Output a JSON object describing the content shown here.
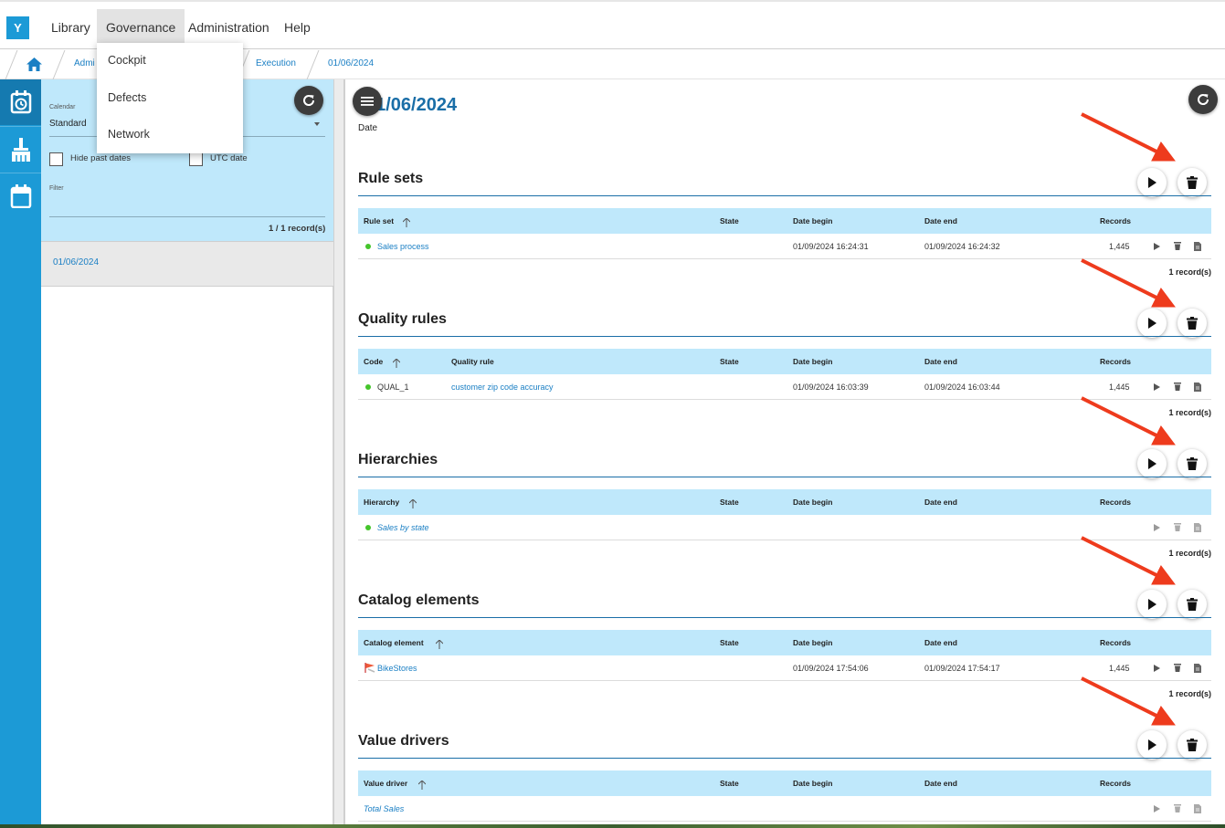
{
  "logo": "Y",
  "menu": [
    "Library",
    "Governance",
    "Administration",
    "Help"
  ],
  "dropdown": [
    "Cockpit",
    "Defects",
    "Network"
  ],
  "breadcrumb": [
    "Admi",
    "Execution",
    "01/06/2024"
  ],
  "left": {
    "calendar_label": "Calendar",
    "calendar_value": "Standard",
    "hide_past": "Hide past dates",
    "utc": "UTC date",
    "filter_label": "Filter",
    "count": "1 / 1 record(s)",
    "item": "01/06/2024"
  },
  "main": {
    "title": "01/06/2024",
    "subtitle": "Date"
  },
  "sections": [
    {
      "title": "Rule sets",
      "headers": [
        "Rule set",
        "State",
        "Date begin",
        "Date end",
        "Records"
      ],
      "row": {
        "c1": "Sales process",
        "c2": "",
        "begin": "01/09/2024 16:24:31",
        "end": "01/09/2024 16:24:32",
        "records": "1,445"
      },
      "count": "1 record(s)"
    },
    {
      "title": "Quality rules",
      "headers": [
        "Code",
        "Quality rule",
        "State",
        "Date begin",
        "Date end",
        "Records"
      ],
      "row": {
        "c1": "QUAL_1",
        "c2": "customer zip code accuracy",
        "begin": "01/09/2024 16:03:39",
        "end": "01/09/2024 16:03:44",
        "records": "1,445"
      },
      "count": "1 record(s)"
    },
    {
      "title": "Hierarchies",
      "headers": [
        "Hierarchy",
        "State",
        "Date begin",
        "Date end",
        "Records"
      ],
      "row": {
        "c1": "Sales by state",
        "c2": "",
        "begin": "",
        "end": "",
        "records": ""
      },
      "count": "1 record(s)"
    },
    {
      "title": "Catalog elements",
      "headers": [
        "Catalog element",
        "State",
        "Date begin",
        "Date end",
        "Records"
      ],
      "row": {
        "c1": "BikeStores",
        "c2": "",
        "begin": "01/09/2024 17:54:06",
        "end": "01/09/2024 17:54:17",
        "records": "1,445"
      },
      "count": "1 record(s)"
    },
    {
      "title": "Value drivers",
      "headers": [
        "Value driver",
        "State",
        "Date begin",
        "Date end",
        "Records"
      ],
      "row": {
        "c1": "Total Sales",
        "c2": "",
        "begin": "",
        "end": "",
        "records": ""
      },
      "count": ""
    }
  ],
  "colors": {
    "accent": "#1c9ad6",
    "header_bg": "#bfe8fb",
    "arrow": "#ee3b1d",
    "status_ok": "#44c52b"
  }
}
